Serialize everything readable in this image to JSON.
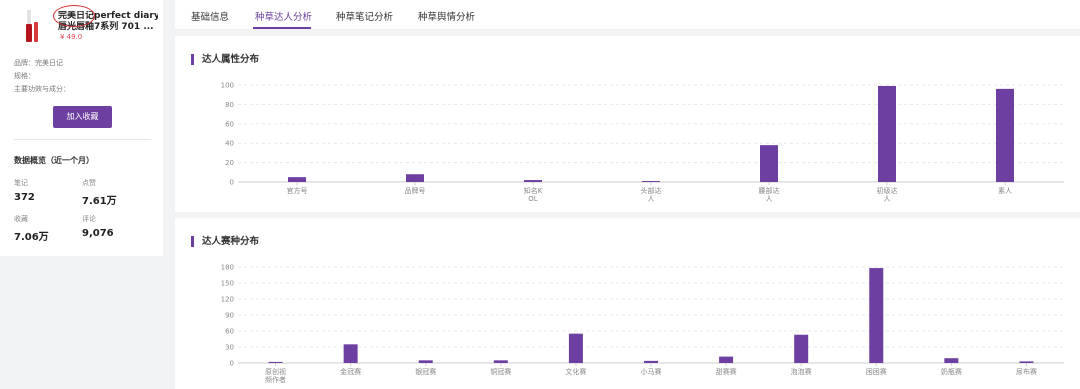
{
  "product": {
    "title_line1": "完美日记perfect diary",
    "title_line2": "唇光唇釉7系列 701 ...",
    "price": "¥ 49.0",
    "brand": "品牌：完美日记",
    "spec": "规格：",
    "efficacy": "主要功效与成分："
  },
  "buttons": {
    "add_favorite": "加入收藏"
  },
  "overview": {
    "title": "数据概览（近一个月）",
    "stats": [
      {
        "label": "笔记",
        "value": "372"
      },
      {
        "label": "点赞",
        "value": "7.61万"
      },
      {
        "label": "收藏",
        "value": "7.06万"
      },
      {
        "label": "评论",
        "value": "9,076"
      }
    ]
  },
  "tabs": [
    "基础信息",
    "种草达人分析",
    "种草笔记分析",
    "种草舆情分析"
  ],
  "active_tab": 1,
  "colors": {
    "accent": "#6c3fa0",
    "price": "#e0474c",
    "annotation": "#d8302f"
  },
  "chart_data": [
    {
      "type": "bar",
      "title": "达人属性分布",
      "categories": [
        "官方号",
        "品牌号",
        "知名KOL",
        "头部达人",
        "腰部达人",
        "初级达人",
        "素人"
      ],
      "category_lines": [
        [
          "官方号"
        ],
        [
          "品牌号"
        ],
        [
          "知名K",
          "OL"
        ],
        [
          "头部达",
          "人"
        ],
        [
          "腰部达",
          "人"
        ],
        [
          "初级达",
          "人"
        ],
        [
          "素人"
        ]
      ],
      "values": [
        5,
        8,
        2,
        1,
        38,
        99,
        96
      ],
      "ylim": [
        0,
        100
      ],
      "yticks": [
        0,
        20,
        40,
        60,
        80,
        100
      ],
      "grid": true
    },
    {
      "type": "bar",
      "title": "达人赛种分布",
      "categories": [
        "原创视频创作者",
        "金冠赛",
        "银冠赛",
        "铜冠赛",
        "文化赛",
        "小马赛",
        "甜赛赛",
        "泡泡赛",
        "困困赛",
        "奶瓶赛",
        "尿布赛"
      ],
      "category_lines": [
        [
          "原创视",
          "频作者"
        ],
        [
          "金冠赛"
        ],
        [
          "银冠赛"
        ],
        [
          "铜冠赛"
        ],
        [
          "文化赛"
        ],
        [
          "小马赛"
        ],
        [
          "甜赛赛"
        ],
        [
          "泡泡赛"
        ],
        [
          "困困赛"
        ],
        [
          "奶瓶赛"
        ],
        [
          "尿布赛"
        ]
      ],
      "values": [
        2,
        35,
        5,
        5,
        55,
        4,
        12,
        53,
        178,
        9,
        3
      ],
      "ylim": [
        0,
        180
      ],
      "yticks": [
        0,
        30,
        60,
        90,
        120,
        150,
        180
      ],
      "grid": true
    }
  ]
}
